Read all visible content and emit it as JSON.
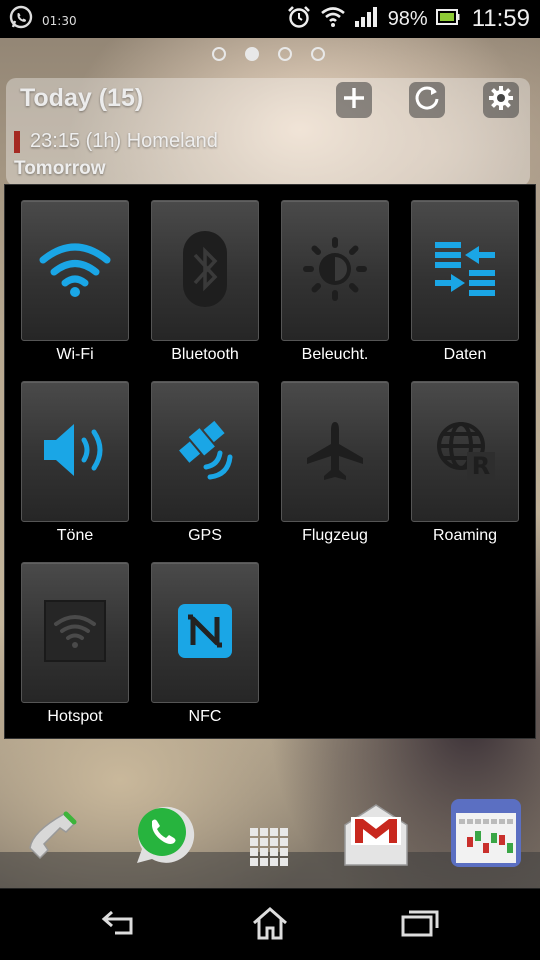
{
  "status_bar": {
    "notification_time": "01:30",
    "battery_percent": "98%",
    "time": "11:59",
    "icons": [
      "whatsapp-icon",
      "alarm-icon",
      "wifi-icon",
      "signal-icon",
      "battery-icon"
    ]
  },
  "home": {
    "pages": 4,
    "active_page": 2
  },
  "agenda_widget": {
    "title": "Today (15)",
    "event": "23:15 (1h) Homeland",
    "event_color": "#a52a22",
    "section": "Tomorrow",
    "buttons": [
      "add-icon",
      "refresh-icon",
      "settings-icon"
    ]
  },
  "toggles": [
    {
      "label": "Wi-Fi",
      "icon": "wifi-icon",
      "active": true
    },
    {
      "label": "Bluetooth",
      "icon": "bluetooth-icon",
      "active": false
    },
    {
      "label": "Beleucht.",
      "icon": "brightness-icon",
      "active": false
    },
    {
      "label": "Daten",
      "icon": "data-transfer-icon",
      "active": true
    },
    {
      "label": "Töne",
      "icon": "speaker-icon",
      "active": true
    },
    {
      "label": "GPS",
      "icon": "gps-satellite-icon",
      "active": true
    },
    {
      "label": "Flugzeug",
      "icon": "airplane-icon",
      "active": false
    },
    {
      "label": "Roaming",
      "icon": "roaming-globe-icon",
      "active": false
    },
    {
      "label": "Hotspot",
      "icon": "hotspot-icon",
      "active": false
    },
    {
      "label": "NFC",
      "icon": "nfc-icon",
      "active": true
    }
  ],
  "colors": {
    "active": "#1aa6e6",
    "inactive": "#1e1e1e"
  },
  "dock": [
    "phone-icon",
    "whatsapp-icon",
    "app-drawer-icon",
    "gmail-icon",
    "calendar-icon"
  ],
  "navigation": [
    "back-icon",
    "home-icon",
    "recent-apps-icon"
  ]
}
